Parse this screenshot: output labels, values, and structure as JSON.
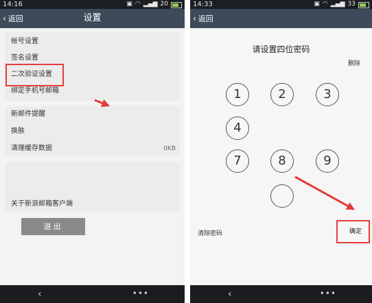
{
  "left_phone": {
    "status": {
      "time": "14:16",
      "signal_label": "20"
    },
    "nav": {
      "back_label": "返回",
      "title": "设置"
    },
    "settings_group_1": [
      {
        "label": "帐号设置"
      },
      {
        "label": "签名设置"
      },
      {
        "label": "二次验证设置"
      },
      {
        "label": "绑定手机号邮箱"
      }
    ],
    "settings_group_2": [
      {
        "label": "新邮件提醒"
      },
      {
        "label": "换肤"
      },
      {
        "label": "清理缓存数据",
        "value": "0KB"
      }
    ],
    "settings_group_3": [
      {
        "label": "关于新浪邮箱客户端"
      }
    ],
    "logout_label": "退出",
    "bottom": {
      "back_glyph": "‹",
      "more_glyph": "•••"
    }
  },
  "right_phone": {
    "status": {
      "time": "14:33",
      "signal_label": "33"
    },
    "nav": {
      "back_label": "返回"
    },
    "pin_title": "请设置四位密码",
    "delete_label": "删除",
    "keys": [
      {
        "label": "1"
      },
      {
        "label": "2"
      },
      {
        "label": "3"
      },
      {
        "label": "4"
      },
      {
        "label": "7"
      },
      {
        "label": "8"
      },
      {
        "label": "9"
      },
      {
        "label": ""
      }
    ],
    "clear_label": "清除密码",
    "confirm_label": "确定",
    "bottom": {
      "back_glyph": "‹",
      "more_glyph": "•••"
    }
  },
  "colors": {
    "navbar": "#3d4a5a",
    "statusbar": "#1c1f22",
    "highlight": "#e53b3b",
    "arrow": "#e53b3b"
  },
  "icons": [
    "wifi-icon",
    "battery-icon",
    "signal-icon",
    "image-icon",
    "chevron-left-icon",
    "more-icon",
    "red-arrow-icon"
  ]
}
